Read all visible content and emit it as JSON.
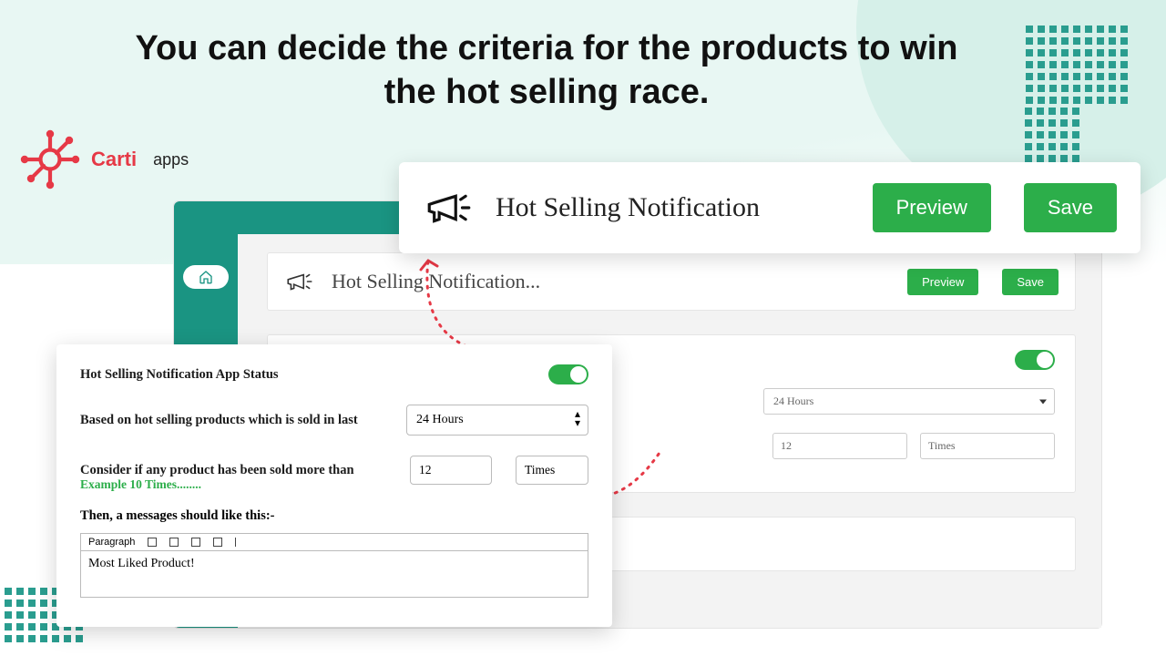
{
  "hero_title": "You can decide the criteria for the products to win the hot selling race.",
  "brand": {
    "name": "Carti",
    "suffix": "apps"
  },
  "front_header": {
    "title": "Hot Selling Notification",
    "preview": "Preview",
    "save": "Save"
  },
  "back_header": {
    "title": "Hot Selling Notification...",
    "preview": "Preview",
    "save": "Save"
  },
  "settings": {
    "status_label": "Hot Selling Notification App Status",
    "based_label": "Based on hot selling products which is sold in last",
    "time_window": "24 Hours",
    "consider_label": "Consider if any product has been sold more than",
    "example": "Example 10 Times........",
    "count_value": "12",
    "times_label": "Times",
    "msg_label": "Then, a messages should like this:-",
    "editor_style": "Paragraph",
    "editor_text": "Most Liked Product!"
  },
  "back_settings": {
    "time_window": "24 Hours",
    "count_value": "12",
    "times_label": "Times"
  }
}
